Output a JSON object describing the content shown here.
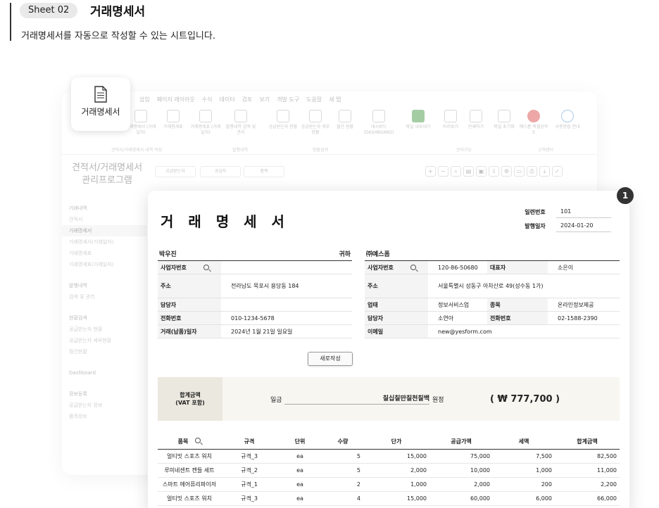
{
  "header": {
    "sheet_label": "Sheet 02",
    "sheet_title": "거래명세서",
    "description": "거래명세서를 자동으로 작성할 수 있는 시트입니다."
  },
  "app": {
    "menu": [
      "삽입",
      "페이지 레이아웃",
      "수식",
      "데이터",
      "검토",
      "보기",
      "개발 도구",
      "도움말",
      "새 탭"
    ],
    "ribbon": [
      {
        "label": "거래명세서 (거래일자)",
        "icon": "document-icon"
      },
      {
        "label": "거래명세표",
        "icon": "table-icon"
      },
      {
        "label": "거래명세표 (거래일자)",
        "icon": "table-icon"
      },
      {
        "label": "발행내역 검색 및 관리",
        "icon": "search-document-icon"
      },
      {
        "label": "공급받는자 현황",
        "icon": "grid-icon"
      },
      {
        "label": "공급받는자 세부현황",
        "icon": "grid-icon"
      },
      {
        "label": "월간 현황",
        "icon": "calendar-icon"
      },
      {
        "label": "대시보드 (DASHBOARD)",
        "icon": "dashboard-icon"
      },
      {
        "label": "파일 내보내기",
        "icon": "excel-icon"
      },
      {
        "label": "미리보기",
        "icon": "preview-icon"
      },
      {
        "label": "인쇄하기",
        "icon": "print-icon"
      },
      {
        "label": "파일 초기화",
        "icon": "trash-icon"
      },
      {
        "label": "예스폼 엑셀공작소",
        "icon": "yesform-icon"
      },
      {
        "label": "사용방법 안내",
        "icon": "info-icon"
      }
    ],
    "ribbon_groups": [
      "견적서/거래명세서 내역 작성",
      "발행내역",
      "현황검색",
      "관리기능",
      "고객센터"
    ],
    "title_line1": "견적서/거래명세서",
    "title_line2": "관리프로그램",
    "filter_buttons": [
      "공급받는자",
      "공급자",
      "품목"
    ],
    "toolbar_icons": [
      "+",
      "−",
      "⌕",
      "▤",
      "▣",
      "⇩",
      "⚙",
      "▭",
      "⎙",
      "⤓",
      "✓"
    ],
    "nav": {
      "group1": "거래내역",
      "items1": [
        "견적서",
        "거래명세서",
        "거래명세서(거래일자)",
        "거래명세표",
        "거래명세표(거래일자)"
      ],
      "group2": "발행내역",
      "items2": [
        "검색 및 관리"
      ],
      "group3": "현황검색",
      "items3": [
        "공급받는자 현황",
        "공급받는자 세부현황",
        "월간현황"
      ],
      "group4": "Dashboard",
      "group5": "정보등록",
      "items5": [
        "공급받는자 정보",
        "품목정보"
      ]
    },
    "badge_label": "거래명세서"
  },
  "invoice": {
    "title": "거 래 명 세 서",
    "badge_number": "1",
    "serial_label": "일련번호",
    "serial_value": "101",
    "issue_label": "발행일자",
    "issue_value": "2024-01-20",
    "buyer": {
      "name": "박우진",
      "suffix": "귀하",
      "rows": [
        {
          "label": "사업자번호",
          "value": ""
        },
        {
          "label": "주소",
          "value": "전라남도 목포시 용당동 184"
        },
        {
          "label": "담당자",
          "value": ""
        },
        {
          "label": "전화번호",
          "value": "010-1234-5678"
        },
        {
          "label": "거래(납품)일자",
          "value": "2024년 1월 21일 일요일"
        }
      ]
    },
    "seller": {
      "name": "㈜예스폼",
      "bizno_label": "사업자번호",
      "bizno": "120-86-50680",
      "ceo_label": "대표자",
      "ceo": "소은이",
      "addr_label": "주소",
      "addr": "서울특별시 성동구 아차산로 49(성수동 1가)",
      "type_label": "업태",
      "type": "정보서비스업",
      "item_label": "종목",
      "item": "온라인정보제공",
      "contact_label": "담당자",
      "contact": "소연아",
      "phone_label": "전화번호",
      "phone": "02-1588-2390",
      "email_label": "이메일",
      "email": "new@yesform.com"
    },
    "new_button": "새로작성",
    "total_label_1": "합계금액",
    "total_label_2": "(VAT 포함)",
    "ilgeum": "일금",
    "amount_hangul": "칠십칠만칠천칠백",
    "won_jeong": "원정",
    "amount_figure": "( ₩ 777,700 )",
    "columns": [
      "품목",
      "규격",
      "단위",
      "수량",
      "단가",
      "공급가액",
      "세액",
      "합계금액"
    ],
    "rows": [
      [
        "얼티밋 스포츠 워치",
        "규격_3",
        "ea",
        "5",
        "15,000",
        "75,000",
        "7,500",
        "82,500"
      ],
      [
        "루미네센트 캔들 세트",
        "규격_2",
        "ea",
        "5",
        "2,000",
        "10,000",
        "1,000",
        "11,000"
      ],
      [
        "스마트 에어퓨리파이저",
        "규격_1",
        "ea",
        "2",
        "1,000",
        "2,000",
        "200",
        "2,200"
      ],
      [
        "얼티밋 스포츠 워치",
        "규격_3",
        "ea",
        "4",
        "15,000",
        "60,000",
        "6,000",
        "66,000"
      ]
    ]
  }
}
